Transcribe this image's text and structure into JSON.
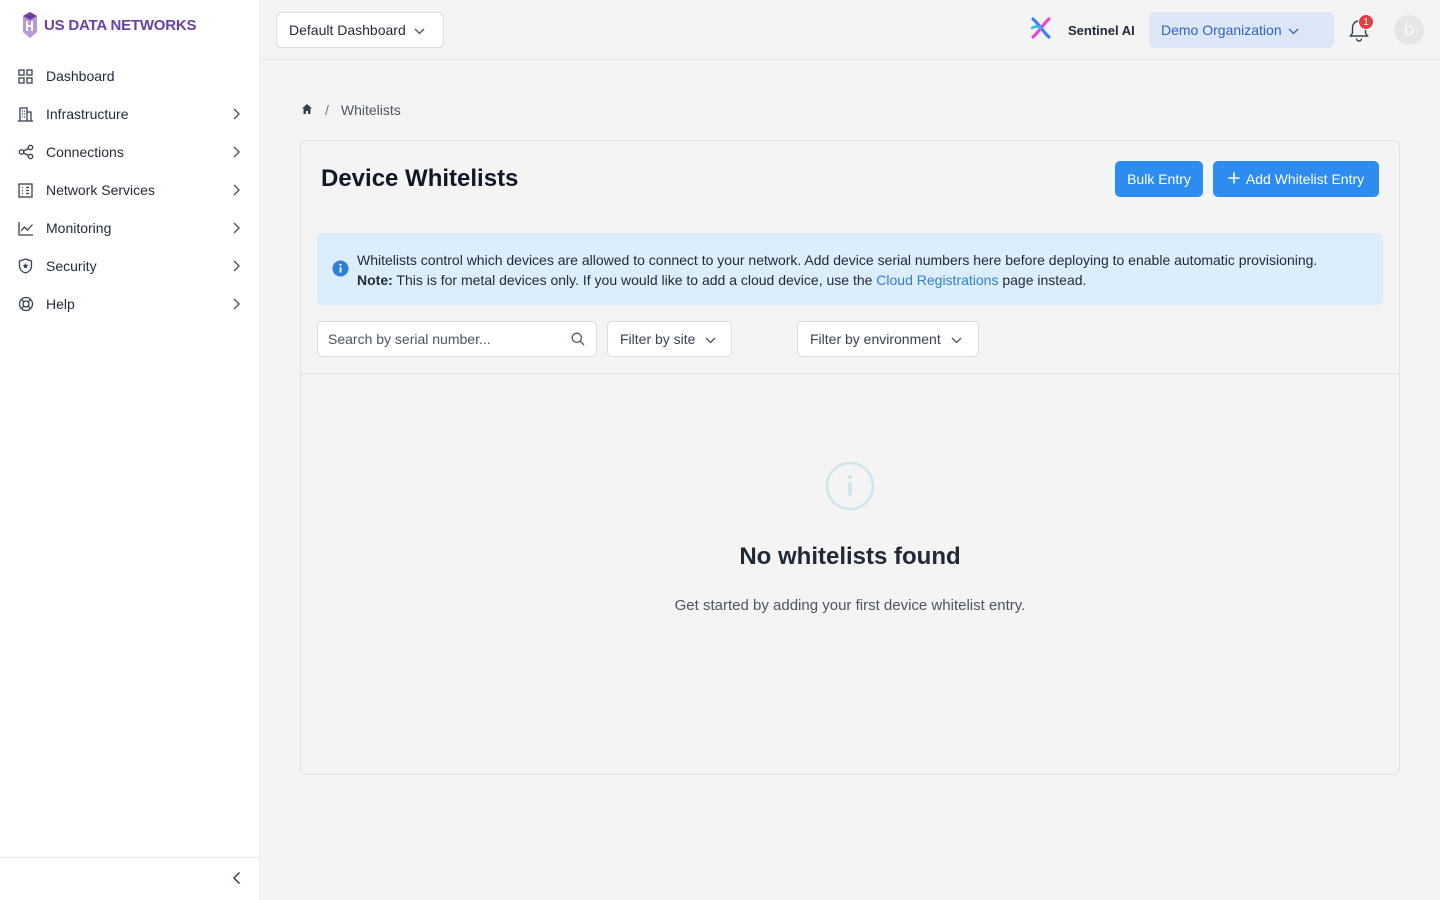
{
  "brand": {
    "name": "US DATA NETWORKS",
    "color": "#6b3fa0"
  },
  "sidebar": {
    "items": [
      {
        "label": "Dashboard",
        "icon": "grid-icon",
        "has_children": false
      },
      {
        "label": "Infrastructure",
        "icon": "building-icon",
        "has_children": true
      },
      {
        "label": "Connections",
        "icon": "share-nodes-icon",
        "has_children": true
      },
      {
        "label": "Network Services",
        "icon": "server-icon",
        "has_children": true
      },
      {
        "label": "Monitoring",
        "icon": "line-chart-icon",
        "has_children": true
      },
      {
        "label": "Security",
        "icon": "shield-icon",
        "has_children": true
      },
      {
        "label": "Help",
        "icon": "lifebuoy-icon",
        "has_children": true
      }
    ],
    "collapse_icon": "chevron-left-icon"
  },
  "header": {
    "dashboard_select": "Default Dashboard",
    "sentinel_label": "Sentinel AI",
    "org_select": "Demo Organization",
    "notification_count": "1",
    "avatar_initial": "D"
  },
  "breadcrumb": {
    "home_icon": "home-icon",
    "separator": "/",
    "current": "Whitelists"
  },
  "page": {
    "title": "Device Whitelists",
    "bulk_button": "Bulk Entry",
    "add_button": "Add Whitelist Entry",
    "info": {
      "line1": "Whitelists control which devices are allowed to connect to your network. Add device serial numbers here before deploying to enable automatic provisioning.",
      "note_label": "Note:",
      "line2_before": " This is for metal devices only. If you would like to add a cloud device, use the ",
      "link": "Cloud Registrations",
      "line2_after": " page instead."
    },
    "search_placeholder": "Search by serial number...",
    "filter_site": "Filter by site",
    "filter_env": "Filter by environment",
    "empty": {
      "title": "No whitelists found",
      "subtitle": "Get started by adding your first device whitelist entry."
    }
  },
  "colors": {
    "primary_button": "#2d8cf0",
    "info_bg": "#dcedfb",
    "org_bg": "#dde6f7",
    "badge": "#e53e3e"
  }
}
